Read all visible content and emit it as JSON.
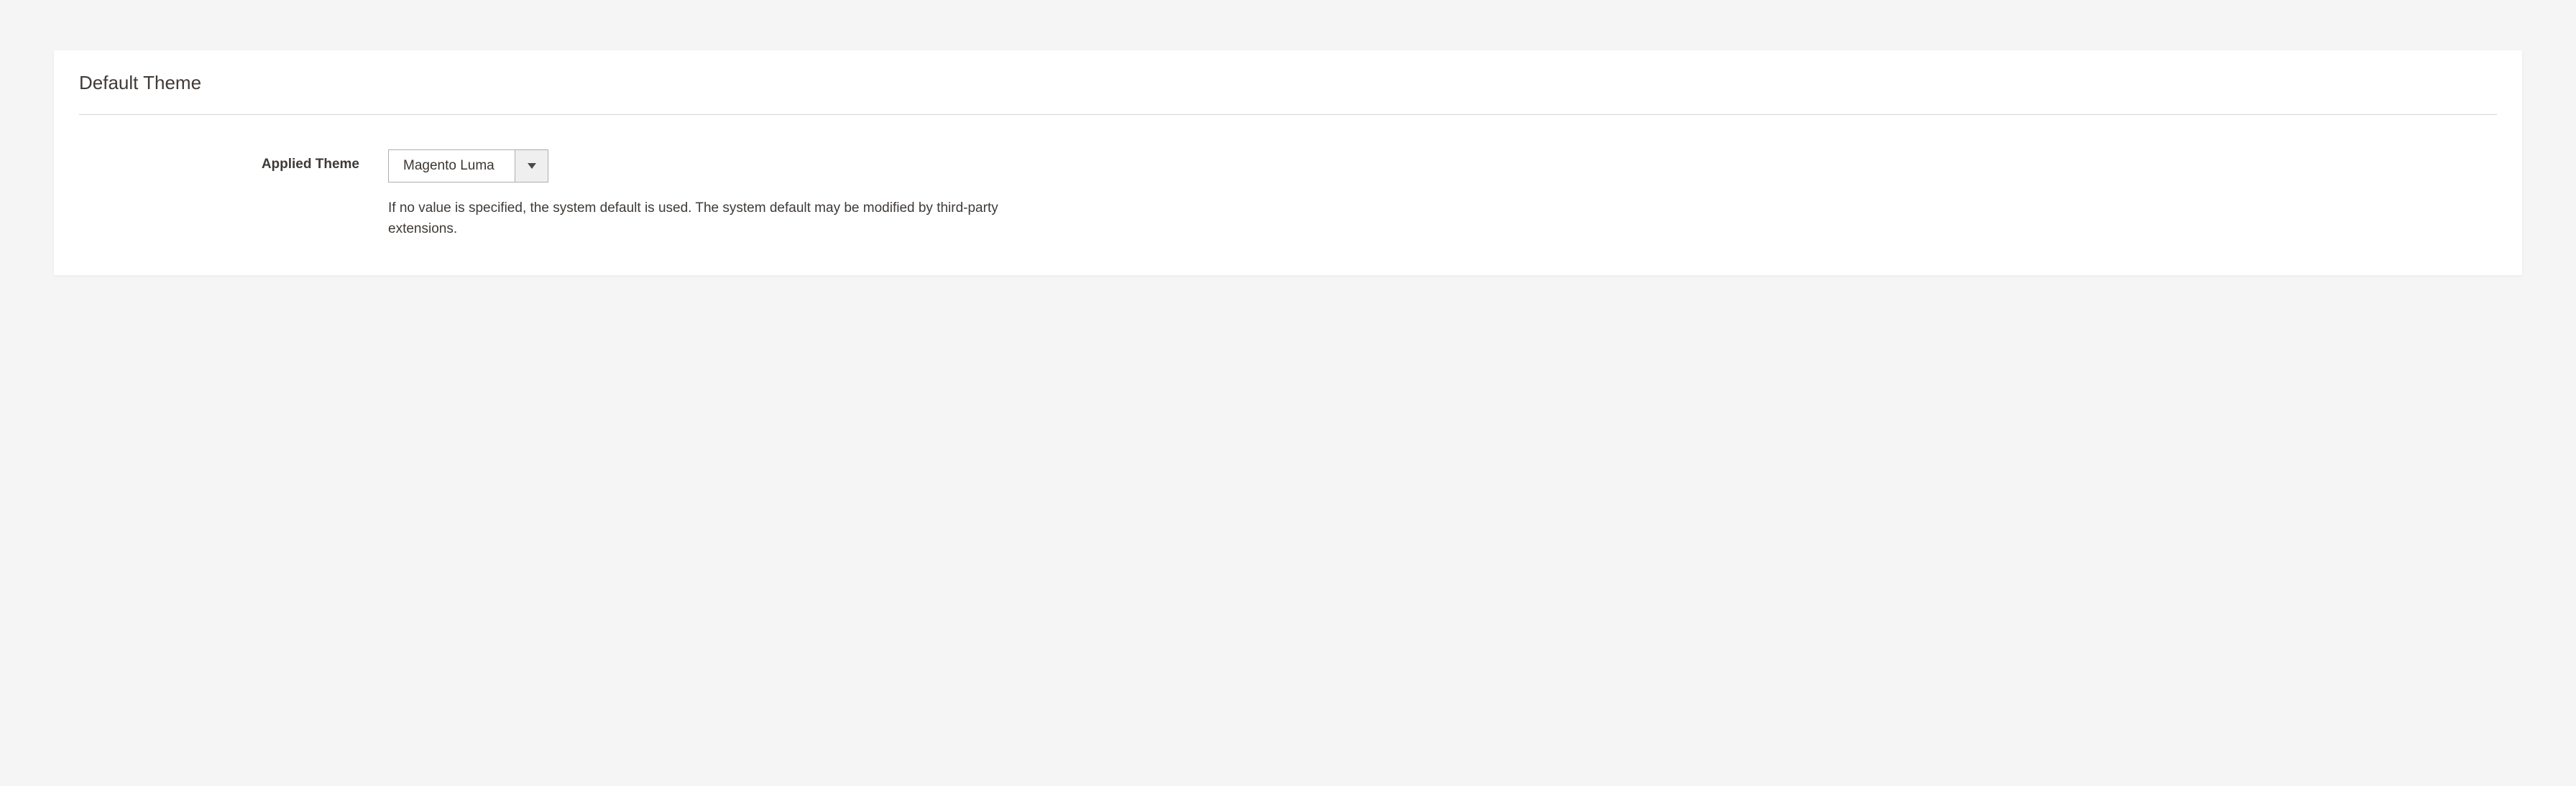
{
  "section": {
    "title": "Default Theme"
  },
  "form": {
    "applied_theme": {
      "label": "Applied Theme",
      "value": "Magento Luma",
      "help": "If no value is specified, the system default is used. The system default may be modified by third-party extensions."
    }
  }
}
